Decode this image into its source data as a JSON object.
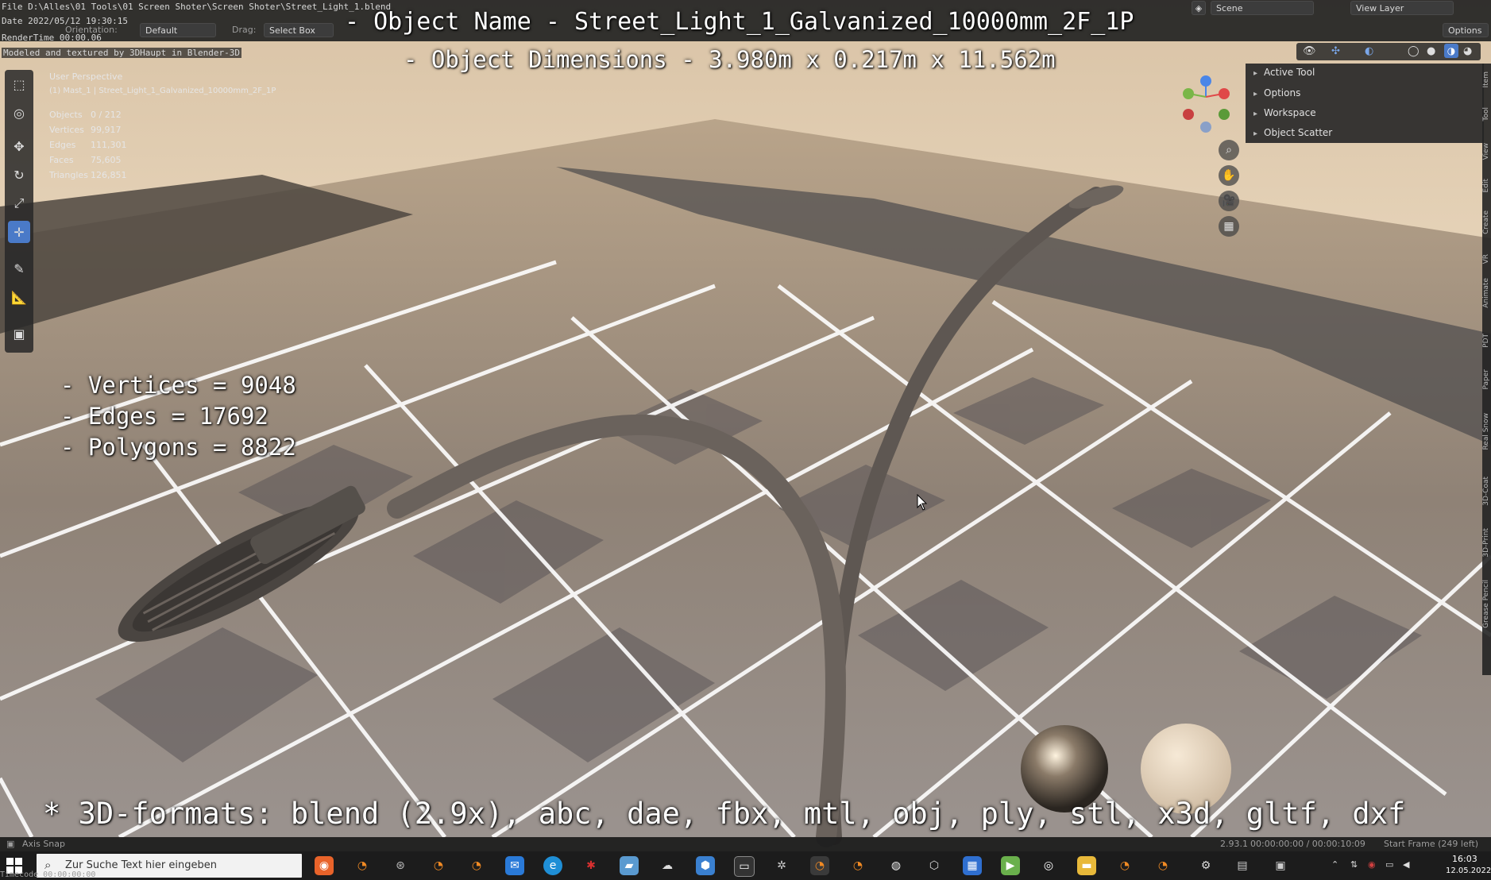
{
  "window": {
    "file_path": "File D:\\Alles\\01 Tools\\01 Screen Shoter\\Screen Shoter\\Street_Light_1.blend",
    "date": "Date 2022/05/12 19:30:15",
    "render_time": "RenderTime 00:00.06",
    "credit": "Modeled and textured by 3DHaupt in Blender-3D"
  },
  "header": {
    "orientation_label": "Orientation:",
    "orientation_value": "Default",
    "drag_label": "Drag:",
    "drag_value": "Select Box",
    "scene_label": "Scene",
    "view_layer_label": "View Layer",
    "options_label": "Options"
  },
  "overlay": {
    "object_name": "- Object Name - Street_Light_1_Galvanized_10000mm_2F_1P",
    "object_dimensions": "- Object Dimensions -  3.980m x 0.217m x 11.562m",
    "vertices": "- Vertices = 9048",
    "edges": "- Edges = 17692",
    "polygons": "- Polygons = 8822",
    "formats": "* 3D-formats: blend (2.9x), abc, dae, fbx, mtl, obj, ply, stl, x3d, gltf, dxf"
  },
  "viewport": {
    "perspective": "User Perspective",
    "active_object": "(1) Mast_1 | Street_Light_1_Galvanized_10000mm_2F_1P",
    "stats": [
      {
        "key": "Objects",
        "value": "0 / 212"
      },
      {
        "key": "Vertices",
        "value": "99,917"
      },
      {
        "key": "Edges",
        "value": "111,301"
      },
      {
        "key": "Faces",
        "value": "75,605"
      },
      {
        "key": "Triangles",
        "value": "126,851"
      }
    ]
  },
  "npanel": {
    "items": [
      "Active Tool",
      "Options",
      "Workspace",
      "Object Scatter"
    ],
    "tabs": [
      "Item",
      "Tool",
      "View",
      "Edit",
      "Create",
      "VR",
      "Animate",
      "PDT",
      "Paper",
      "Real Snow",
      "3D-Coat",
      "3D-Print",
      "Grease Pencil"
    ]
  },
  "gizmo": {
    "x": "X",
    "y": "Y",
    "z": "Z"
  },
  "statusbar": {
    "left": "Axis Snap",
    "version": "2.93.1",
    "timecode": "00:00:00:00 / 00:00:10:09",
    "frame": "Start Frame (249 left)"
  },
  "taskbar": {
    "search_placeholder": "Zur Suche Text hier eingeben",
    "time": "16:03",
    "date": "12.05.2022",
    "bottom_timecode": "Timecode 00:00:00:00"
  },
  "colors": {
    "accent": "#4a7ac8",
    "taskbar": "#1c1c1c",
    "panel": "#282828"
  }
}
